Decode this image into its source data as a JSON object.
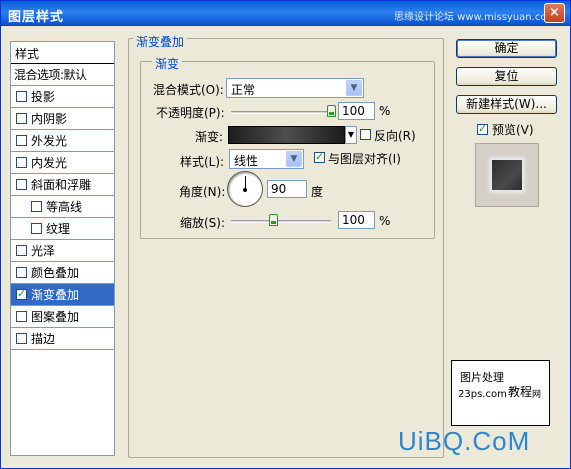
{
  "window": {
    "title": "图层样式",
    "watermark": "思缘设计论坛 www.missyuan.com",
    "close_glyph": "×"
  },
  "styles_list": {
    "header": "样式",
    "blend_options": "混合选项:默认",
    "items": [
      {
        "label": "投影",
        "checked": false
      },
      {
        "label": "内阴影",
        "checked": false
      },
      {
        "label": "外发光",
        "checked": false
      },
      {
        "label": "内发光",
        "checked": false
      },
      {
        "label": "斜面和浮雕",
        "checked": false
      },
      {
        "label": "等高线",
        "checked": false
      },
      {
        "label": "纹理",
        "checked": false
      },
      {
        "label": "光泽",
        "checked": false
      },
      {
        "label": "颜色叠加",
        "checked": false
      },
      {
        "label": "渐变叠加",
        "checked": true
      },
      {
        "label": "图案叠加",
        "checked": false
      },
      {
        "label": "描边",
        "checked": false
      }
    ]
  },
  "gradient_overlay": {
    "group_title": "渐变叠加",
    "subgroup_title": "渐变",
    "blend_mode_label": "混合模式(O):",
    "blend_mode_value": "正常",
    "opacity_label": "不透明度(P):",
    "opacity_value": "100",
    "opacity_unit": "%",
    "opacity_level": 1.0,
    "gradient_label": "渐变:",
    "reverse_label": "反向(R)",
    "reverse_checked": false,
    "style_label": "样式(L):",
    "style_value": "线性",
    "align_label": "与图层对齐(I)",
    "align_checked": true,
    "angle_label": "角度(N):",
    "angle_value": "90",
    "angle_unit": "度",
    "scale_label": "缩放(S):",
    "scale_value": "100",
    "scale_unit": "%",
    "scale_level": 0.42
  },
  "buttons": {
    "ok": "确定",
    "reset": "复位",
    "new_style": "新建样式(W)...",
    "preview_label": "预览(V)",
    "preview_checked": true
  },
  "logo": {
    "line1": "图片处理",
    "line2": "23ps.com",
    "line3": "教程",
    "line4": "网"
  },
  "footer_watermark": "UiBQ.CoM"
}
